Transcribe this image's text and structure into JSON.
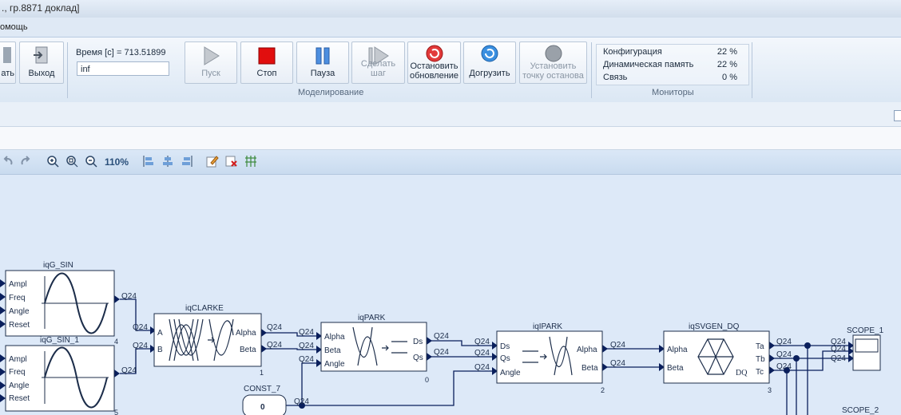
{
  "window": {
    "title": "., гр.8871 доклад]"
  },
  "menu": {
    "help_label": "омощь"
  },
  "ribbon": {
    "partial_button_label": "ать",
    "exit_label": "Выход",
    "time_label": "Время [с]",
    "time_value": "= 713.51899",
    "end_time_value": "inf",
    "start_label": "Пуск",
    "stop_label": "Стоп",
    "pause_label": "Пауза",
    "step_label": "Сделать шаг",
    "stop_update_label_1": "Остановить",
    "stop_update_label_2": "обновление",
    "reload_label": "Догрузить",
    "breakpoint_label_1": "Установить",
    "breakpoint_label_2": "точку останова",
    "group_modeling": "Моделирование",
    "group_monitors": "Мониторы",
    "monitors": [
      {
        "name": "Конфигурация",
        "value": "22 %"
      },
      {
        "name": "Динамическая память",
        "value": "22 %"
      },
      {
        "name": "Связь",
        "value": "0 %"
      }
    ]
  },
  "toolbar": {
    "zoom_label": "110%"
  },
  "diagram": {
    "blocks": {
      "sin": {
        "title": "iqG_SIN",
        "inputs": [
          "Ampl",
          "Freq",
          "Angle",
          "Reset"
        ],
        "order": "4"
      },
      "sin1": {
        "title": "iqG_SIN_1",
        "inputs": [
          "Ampl",
          "Freq",
          "Angle",
          "Reset"
        ],
        "order": "5"
      },
      "clarke": {
        "title": "iqCLARKE",
        "inputs": [
          "A",
          "B"
        ],
        "outputs": [
          "Alpha",
          "Beta"
        ],
        "order": "1"
      },
      "park": {
        "title": "iqPARK",
        "inputs": [
          "Alpha",
          "Beta",
          "Angle"
        ],
        "outputs": [
          "Ds",
          "Qs"
        ],
        "order": "0"
      },
      "ipark": {
        "title": "iqIPARK",
        "inputs": [
          "Ds",
          "Qs",
          "Angle"
        ],
        "outputs": [
          "Alpha",
          "Beta"
        ],
        "order": "2"
      },
      "svgen": {
        "title": "iqSVGEN_DQ",
        "inputs": [
          "Alpha",
          "Beta"
        ],
        "outputs": [
          "Ta",
          "Tb",
          "Tc"
        ],
        "inner_label": "DQ",
        "order": "3"
      },
      "const": {
        "title": "CONST_7",
        "value": "0"
      },
      "scope1": {
        "title": "SCOPE_1"
      },
      "scope2": {
        "title": "SCOPE_2"
      }
    },
    "wire_label": "Q24"
  }
}
